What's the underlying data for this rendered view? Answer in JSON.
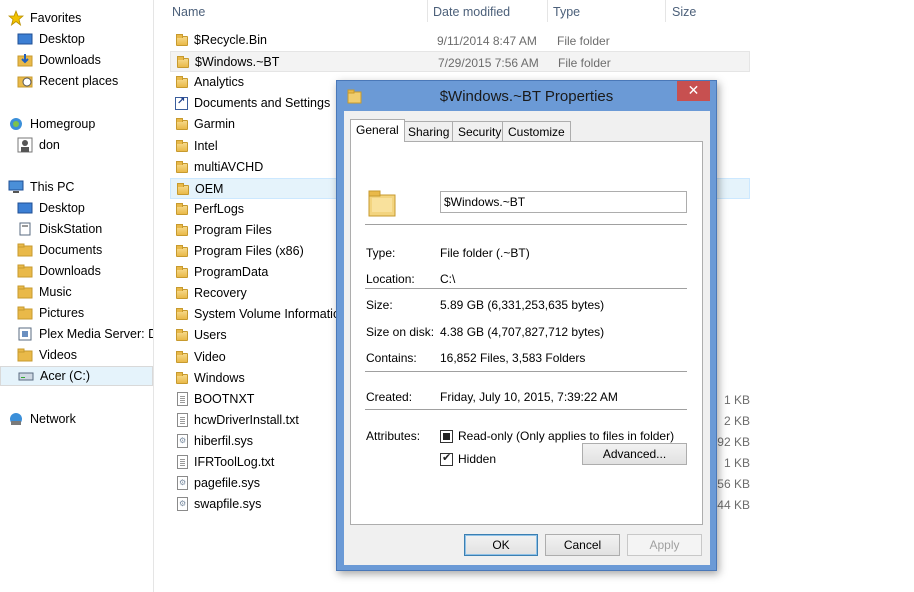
{
  "nav": {
    "favorites": "Favorites",
    "desktop": "Desktop",
    "downloads": "Downloads",
    "recent_places": "Recent places",
    "homegroup": "Homegroup",
    "homegroup_user": "don",
    "this_pc": "This PC",
    "pc_items": [
      "Desktop",
      "DiskStation",
      "Documents",
      "Downloads",
      "Music",
      "Pictures",
      "Plex Media Server: Dis",
      "Videos",
      "Acer (C:)"
    ],
    "network": "Network"
  },
  "columns": {
    "name": "Name",
    "date": "Date modified",
    "type": "Type",
    "size": "Size"
  },
  "files": [
    {
      "name": "$Recycle.Bin",
      "date": "9/11/2014 8:47 AM",
      "type": "File folder",
      "size": "",
      "icon": "folder"
    },
    {
      "name": "$Windows.~BT",
      "date": "7/29/2015 7:56 AM",
      "type": "File folder",
      "size": "",
      "icon": "folder"
    },
    {
      "name": "Analytics",
      "date": "",
      "type": "",
      "size": "",
      "icon": "folder"
    },
    {
      "name": "Documents and Settings",
      "date": "",
      "type": "",
      "size": "",
      "icon": "shortcut"
    },
    {
      "name": "Garmin",
      "date": "",
      "type": "",
      "size": "",
      "icon": "folder"
    },
    {
      "name": "Intel",
      "date": "",
      "type": "",
      "size": "",
      "icon": "folder"
    },
    {
      "name": "multiAVCHD",
      "date": "",
      "type": "",
      "size": "",
      "icon": "folder"
    },
    {
      "name": "OEM",
      "date": "",
      "type": "",
      "size": "",
      "icon": "folder"
    },
    {
      "name": "PerfLogs",
      "date": "",
      "type": "",
      "size": "",
      "icon": "folder"
    },
    {
      "name": "Program Files",
      "date": "",
      "type": "",
      "size": "",
      "icon": "folder"
    },
    {
      "name": "Program Files (x86)",
      "date": "",
      "type": "",
      "size": "",
      "icon": "folder"
    },
    {
      "name": "ProgramData",
      "date": "",
      "type": "",
      "size": "",
      "icon": "folder"
    },
    {
      "name": "Recovery",
      "date": "",
      "type": "",
      "size": "",
      "icon": "folder"
    },
    {
      "name": "System Volume Information",
      "date": "",
      "type": "",
      "size": "",
      "icon": "folder"
    },
    {
      "name": "Users",
      "date": "",
      "type": "",
      "size": "",
      "icon": "folder"
    },
    {
      "name": "Video",
      "date": "",
      "type": "",
      "size": "",
      "icon": "folder"
    },
    {
      "name": "Windows",
      "date": "",
      "type": "",
      "size": "",
      "icon": "folder"
    },
    {
      "name": "BOOTNXT",
      "date": "",
      "type": "",
      "size": "1 KB",
      "icon": "file"
    },
    {
      "name": "hcwDriverInstall.txt",
      "date": "",
      "type": "",
      "size": "2 KB",
      "icon": "file"
    },
    {
      "name": "hiberfil.sys",
      "date": "",
      "type": "",
      "size": "92 KB",
      "icon": "sysfile"
    },
    {
      "name": "IFRToolLog.txt",
      "date": "",
      "type": "",
      "size": "1 KB",
      "icon": "file"
    },
    {
      "name": "pagefile.sys",
      "date": "",
      "type": "",
      "size": "56 KB",
      "icon": "sysfile"
    },
    {
      "name": "swapfile.sys",
      "date": "",
      "type": "",
      "size": "44 KB",
      "icon": "sysfile"
    }
  ],
  "dialog": {
    "title": "$Windows.~BT Properties",
    "close": "✕",
    "tabs": [
      "General",
      "Sharing",
      "Security",
      "Customize"
    ],
    "name_value": "$Windows.~BT",
    "type_label": "Type:",
    "type_value": "File folder (.~BT)",
    "location_label": "Location:",
    "location_value": "C:\\",
    "size_label": "Size:",
    "size_value": "5.89 GB (6,331,253,635 bytes)",
    "size_on_disk_label": "Size on disk:",
    "size_on_disk_value": "4.38 GB (4,707,827,712 bytes)",
    "contains_label": "Contains:",
    "contains_value": "16,852 Files, 3,583 Folders",
    "created_label": "Created:",
    "created_value": "Friday, July 10, 2015, 7:39:22 AM",
    "attributes_label": "Attributes:",
    "readonly_label": "Read-only (Only applies to files in folder)",
    "hidden_label": "Hidden",
    "advanced_button": "Advanced...",
    "ok_button": "OK",
    "cancel_button": "Cancel",
    "apply_button": "Apply"
  }
}
